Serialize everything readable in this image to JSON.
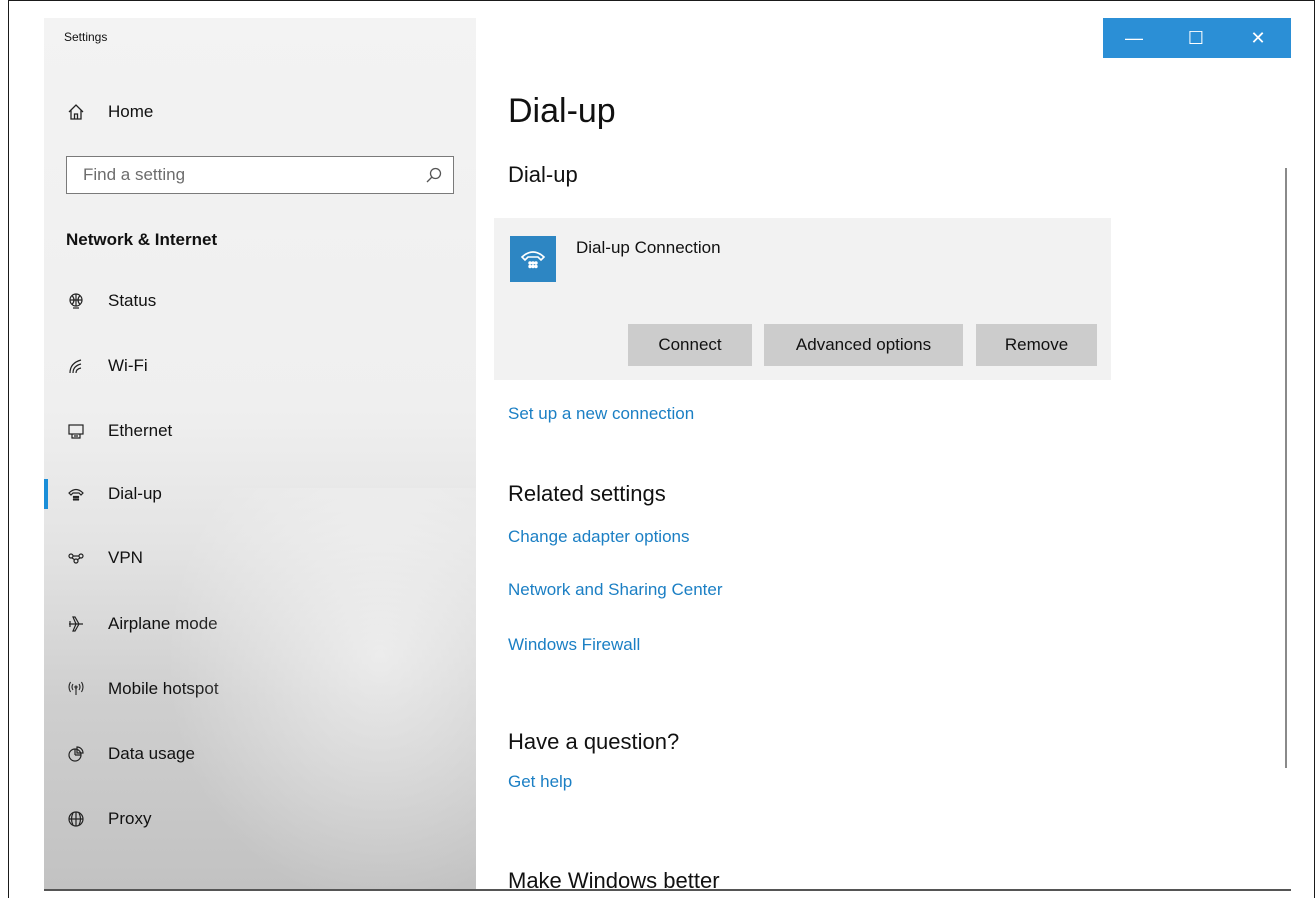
{
  "app": {
    "title": "Settings"
  },
  "sidebar": {
    "home_label": "Home",
    "search_placeholder": "Find a setting",
    "section_title": "Network & Internet",
    "items": [
      {
        "label": "Status",
        "icon": "globe-icon"
      },
      {
        "label": "Wi-Fi",
        "icon": "wifi-icon"
      },
      {
        "label": "Ethernet",
        "icon": "ethernet-icon"
      },
      {
        "label": "Dial-up",
        "icon": "dialup-icon",
        "selected": true
      },
      {
        "label": "VPN",
        "icon": "vpn-icon"
      },
      {
        "label": "Airplane mode",
        "icon": "airplane-icon"
      },
      {
        "label": "Mobile hotspot",
        "icon": "hotspot-icon"
      },
      {
        "label": "Data usage",
        "icon": "data-usage-icon"
      },
      {
        "label": "Proxy",
        "icon": "proxy-globe-icon"
      }
    ]
  },
  "window_controls": {
    "minimize": "—",
    "maximize": "☐",
    "close": "✕"
  },
  "main": {
    "title": "Dial-up",
    "subtitle": "Dial-up",
    "connection": {
      "name": "Dial-up Connection",
      "buttons": {
        "connect": "Connect",
        "advanced": "Advanced options",
        "remove": "Remove"
      }
    },
    "setup_link": "Set up a new connection",
    "related": {
      "heading": "Related settings",
      "links": [
        "Change adapter options",
        "Network and Sharing Center",
        "Windows Firewall"
      ]
    },
    "question": {
      "heading": "Have a question?",
      "link": "Get help"
    },
    "better": {
      "heading": "Make Windows better"
    }
  },
  "colors": {
    "accent": "#2b8fd6",
    "link": "#1b7fc4",
    "card": "#f2f2f2",
    "button": "#cccccc"
  }
}
